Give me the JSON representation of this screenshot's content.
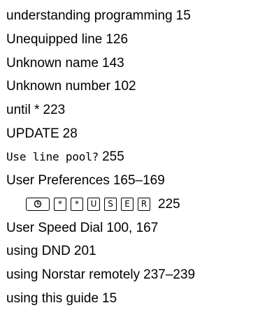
{
  "index_entries": [
    {
      "term": "understanding programming",
      "pages": "15"
    },
    {
      "term": "Unequipped line",
      "pages": "126"
    },
    {
      "term": "Unknown name",
      "pages": "143"
    },
    {
      "term": "Unknown number",
      "pages": "102"
    },
    {
      "term": "until *",
      "pages": "223"
    },
    {
      "term": "UPDATE",
      "pages": "28"
    },
    {
      "term": "Use line pool?",
      "pages": "255"
    },
    {
      "term": "User Preferences",
      "pages": "165–169"
    },
    {
      "keys": [
        "feature-key",
        "*",
        "*",
        "U",
        "S",
        "E",
        "R"
      ],
      "pages": "225"
    },
    {
      "term": "User Speed Dial",
      "pages": "100, 167"
    },
    {
      "term": "using DND",
      "pages": "201"
    },
    {
      "term": "using Norstar remotely",
      "pages": "237–239"
    },
    {
      "term": "using this guide",
      "pages": "15"
    }
  ]
}
